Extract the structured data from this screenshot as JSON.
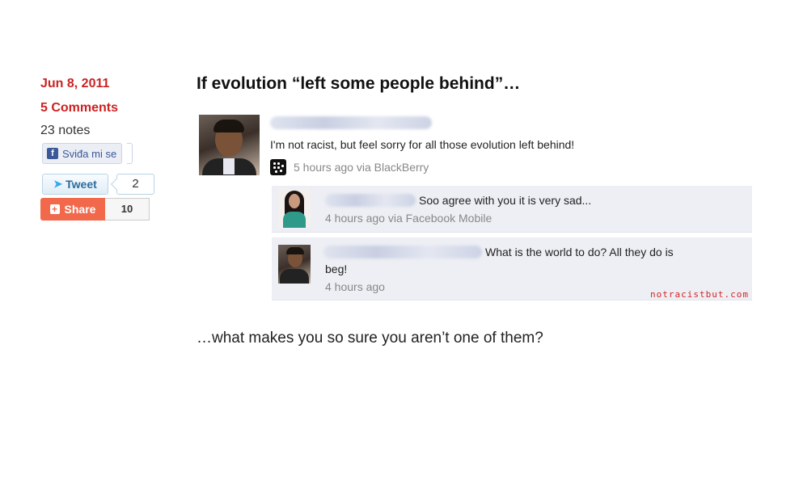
{
  "sidebar": {
    "date": "Jun 8, 2011",
    "comments": "5 Comments",
    "notes": "23 notes"
  },
  "social": {
    "facebook_like_label": "Sviđa mi se",
    "tweet_label": "Tweet",
    "tweet_count": "2",
    "share_label": "Share",
    "share_count": "10"
  },
  "post": {
    "title": "If evolution “left some people behind”…",
    "closing_line": "…what makes you so sure you aren’t one of them?"
  },
  "screenshot": {
    "status_text": "I'm not racist, but feel sorry for all those evolution left behind!",
    "status_meta": "5 hours ago via BlackBerry",
    "comments": [
      {
        "text": "Soo agree with you it is very sad...",
        "time": "4 hours ago via Facebook Mobile"
      },
      {
        "text_line1": "What is the world to do? All they do is",
        "text_line2": "beg!",
        "time": "4 hours ago"
      }
    ],
    "watermark": "notracistbut.com"
  },
  "colors": {
    "accent_red": "#cc2222",
    "facebook_blue": "#3b5998",
    "share_orange": "#f2684b",
    "comment_bg": "#edeff4"
  },
  "icons": [
    "facebook-f-icon",
    "twitter-bird-icon",
    "share-plus-icon",
    "blackberry-icon"
  ]
}
